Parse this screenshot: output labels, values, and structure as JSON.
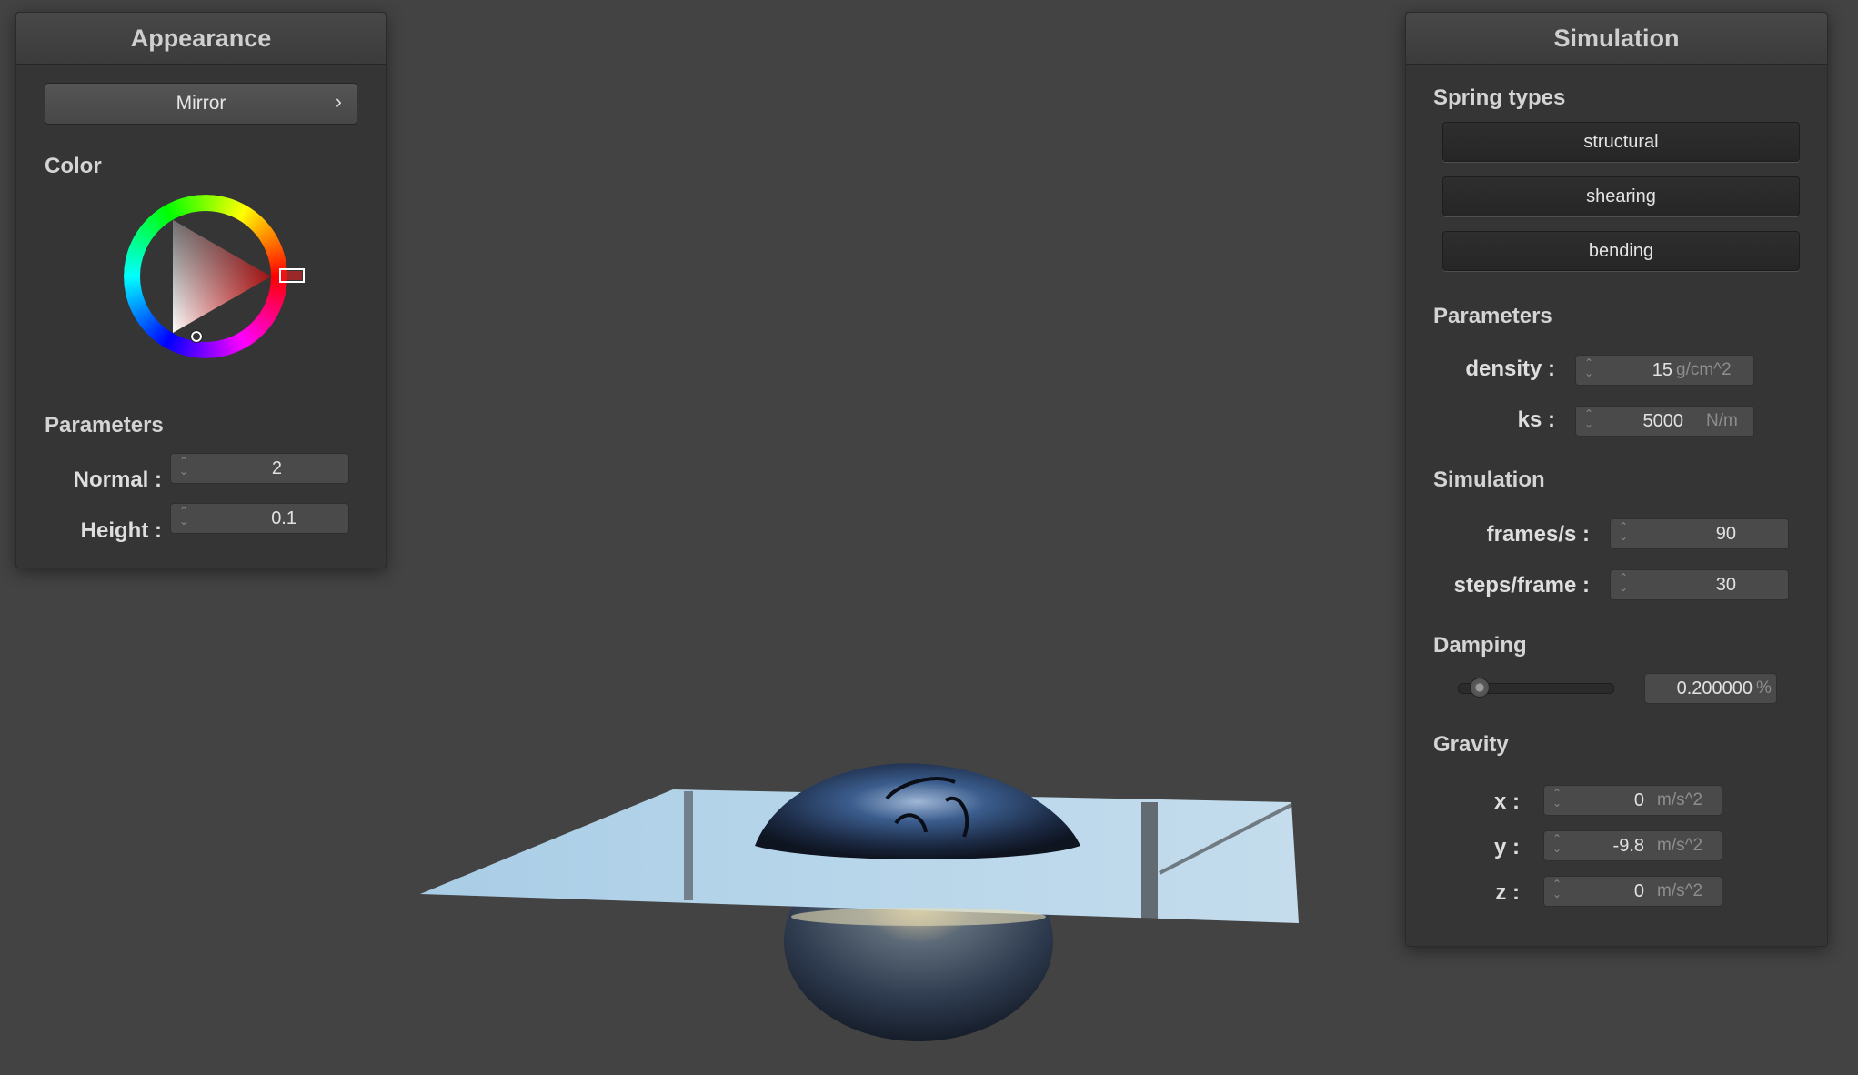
{
  "appearance": {
    "title": "Appearance",
    "shader_select": "Mirror",
    "chevron_glyph": "›",
    "color_label": "Color",
    "parameters_label": "Parameters",
    "normal_label": "Normal :",
    "normal_value": "2",
    "height_label": "Height :",
    "height_value": "0.1",
    "selected_color": "#e02020"
  },
  "simulation": {
    "title": "Simulation",
    "spring_types_label": "Spring types",
    "spring_buttons": [
      "structural",
      "shearing",
      "bending"
    ],
    "parameters_label": "Parameters",
    "density_label": "density :",
    "density_value": "15",
    "density_unit": "g/cm^2",
    "ks_label": "ks :",
    "ks_value": "5000",
    "ks_unit": "N/m",
    "simulation_label": "Simulation",
    "fps_label": "frames/s :",
    "fps_value": "90",
    "steps_label": "steps/frame :",
    "steps_value": "30",
    "damping_label": "Damping",
    "damping_value": "0.200000",
    "damping_unit": "%",
    "damping_slider_level": 0.2,
    "gravity_label": "Gravity",
    "gx_label": "x :",
    "gx_value": "0",
    "gy_label": "y :",
    "gy_value": "-9.8",
    "gz_label": "z :",
    "gz_value": "0",
    "gravity_unit": "m/s^2"
  },
  "icons": {
    "spin_arrows": "⌃⌄"
  },
  "colors": {
    "background": "#434343",
    "panel": "#353535",
    "accent_red": "#e02020"
  }
}
